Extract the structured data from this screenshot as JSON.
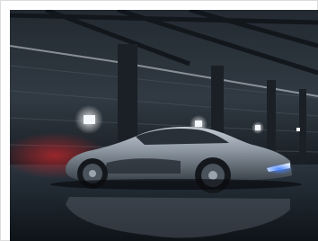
{
  "image": {
    "kind": "photograph",
    "subject": "sports-car-in-hangar",
    "palette": {
      "frame": "#ffffff",
      "wall_dark": "#1b2128",
      "wall_light": "#39424b",
      "floor": "#1d2630",
      "car_body": "#8b959f",
      "car_shadow": "#2a3038",
      "light_white": "#f4f7fb",
      "accent_red": "#b0262a",
      "accent_blue": "#3c7cff"
    }
  }
}
